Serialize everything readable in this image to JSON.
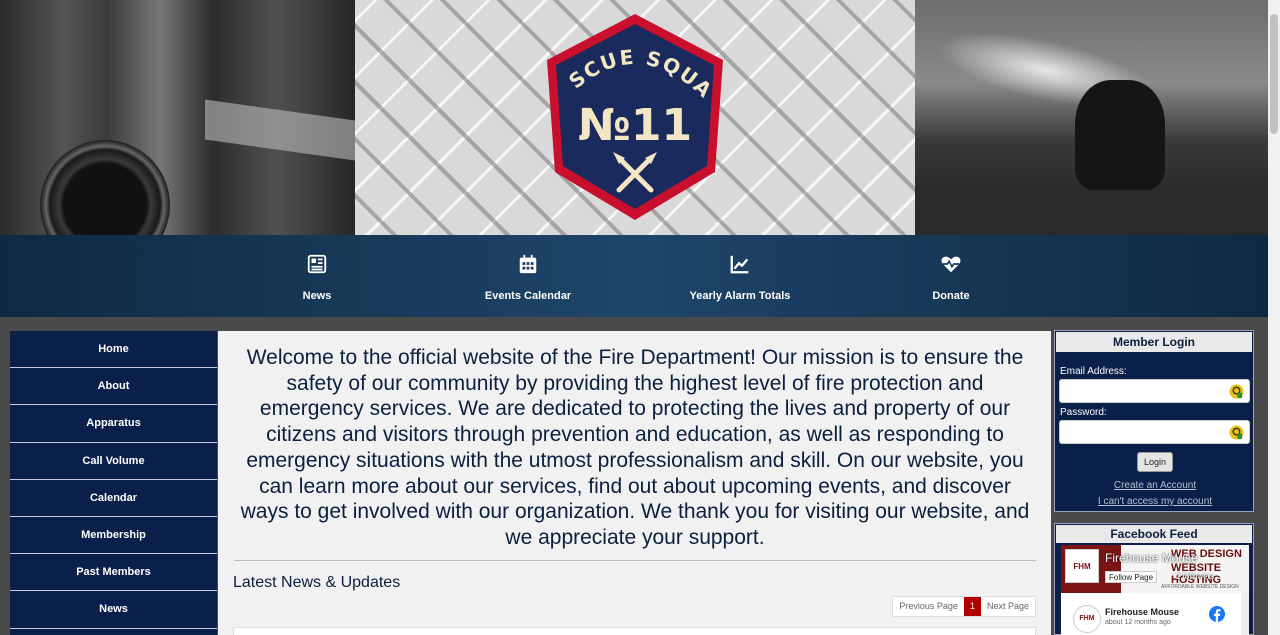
{
  "banner": {
    "badge_top": "RESCUE SQUAD",
    "badge_number": "№11"
  },
  "topnav": [
    {
      "label": "News",
      "icon": "newspaper-icon"
    },
    {
      "label": "Events Calendar",
      "icon": "calendar-icon"
    },
    {
      "label": "Yearly Alarm Totals",
      "icon": "chart-line-icon"
    },
    {
      "label": "Donate",
      "icon": "heartbeat-icon"
    }
  ],
  "sidebar": {
    "items": [
      {
        "label": "Home"
      },
      {
        "label": "About"
      },
      {
        "label": "Apparatus"
      },
      {
        "label": "Call Volume"
      },
      {
        "label": "Calendar"
      },
      {
        "label": "Membership"
      },
      {
        "label": "Past Members"
      },
      {
        "label": "News"
      }
    ]
  },
  "main": {
    "welcome": "Welcome to the official website of the Fire Department! Our mission is to ensure the safety of our community by providing the highest level of fire protection and emergency services. We are dedicated to protecting the lives and property of our citizens and visitors through prevention and education, as well as responding to emergency situations with the utmost professionalism and skill. On our website, you can learn more about our services, find out about upcoming events, and discover ways to get involved with our organization. We thank you for visiting our website, and we appreciate your support.",
    "news_title": "Latest News & Updates",
    "pager": {
      "prev": "Previous Page",
      "current": "1",
      "next": "Next Page"
    }
  },
  "login": {
    "title": "Member Login",
    "email_label": "Email Address:",
    "email_value": "",
    "password_label": "Password:",
    "password_value": "",
    "login_button": "Login",
    "create_account": "Create an Account",
    "cant_access": "I can't access my account"
  },
  "facebook": {
    "title": "Facebook Feed",
    "page_name": "Firehouse Mouse",
    "follow_label": "Follow Page",
    "followers": "2 followers",
    "cover_line1": "WEB DESIGN",
    "cover_line2": "WEBSITE HOSTING",
    "cover_line3": "AFFORDABLE WEBSITE DESIGN",
    "logo_text": "FHM",
    "post_author": "Firehouse Mouse",
    "post_time": "about 12 months ago"
  },
  "colors": {
    "nav_dark": "#0f2942",
    "nav_mid": "#1e4569",
    "sidebar": "#0a1f4a",
    "accent_red": "#b00000",
    "badge_red": "#c8102e",
    "badge_navy": "#1b2a5c",
    "badge_cream": "#f2e6c4"
  }
}
